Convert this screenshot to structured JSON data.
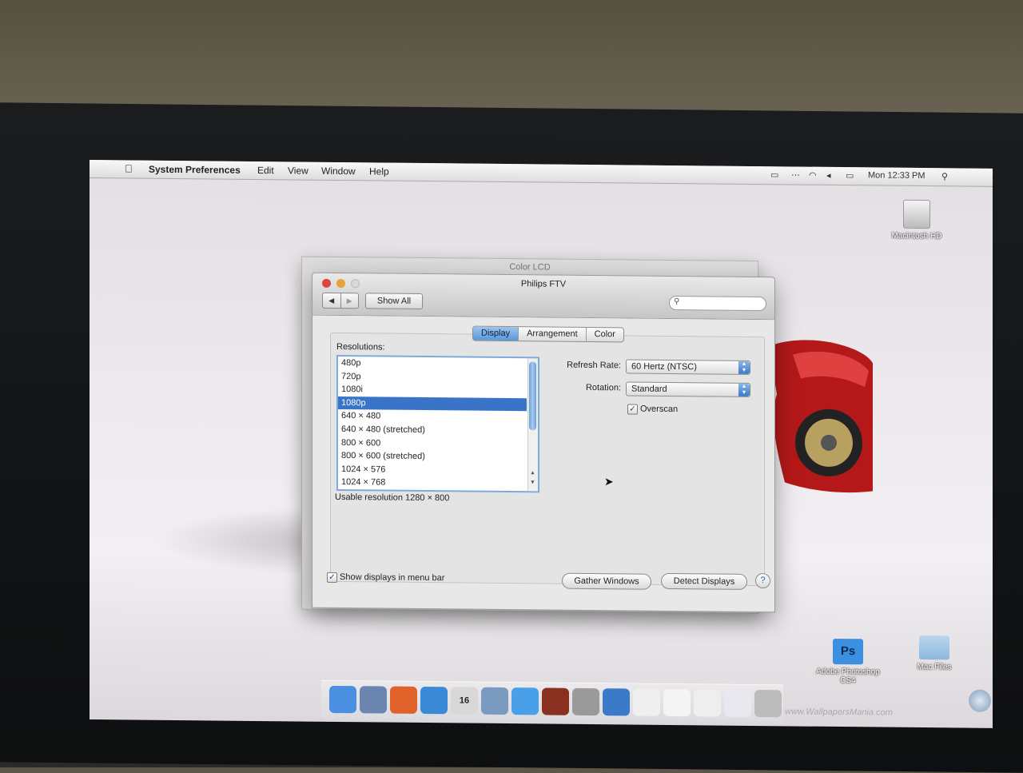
{
  "menubar": {
    "app_name": "System Preferences",
    "items": [
      "Edit",
      "View",
      "Window",
      "Help"
    ],
    "clock": "Mon 12:33 PM"
  },
  "desktop": {
    "icons": [
      {
        "label": "Macintosh HD",
        "icon": "hard-drive-icon"
      },
      {
        "label": "Adobe Photoshop CS4",
        "icon": "photoshop-icon"
      },
      {
        "label": "Mac Files",
        "icon": "folder-icon"
      }
    ],
    "ps_glyph": "Ps",
    "watermark": "www.WallpapersMania.com"
  },
  "back_window": {
    "title": "Color LCD"
  },
  "window": {
    "title": "Philips FTV",
    "toolbar": {
      "back": "◀",
      "forward": "▶",
      "show_all": "Show All",
      "search_placeholder": ""
    },
    "tabs": [
      {
        "label": "Display",
        "active": true
      },
      {
        "label": "Arrangement",
        "active": false
      },
      {
        "label": "Color",
        "active": false
      }
    ],
    "resolutions_label": "Resolutions:",
    "resolutions": [
      "480p",
      "720p",
      "1080i",
      "1080p",
      "640 × 480",
      "640 × 480 (stretched)",
      "800 × 600",
      "800 × 600 (stretched)",
      "1024 × 576",
      "1024 × 768"
    ],
    "selected_resolution": "1080p",
    "usable_resolution": "Usable resolution 1280 × 800",
    "refresh_rate_label": "Refresh Rate:",
    "refresh_rate_value": "60 Hertz (NTSC)",
    "rotation_label": "Rotation:",
    "rotation_value": "Standard",
    "overscan_label": "Overscan",
    "overscan_checked": true,
    "show_displays_label": "Show displays in menu bar",
    "show_displays_checked": true,
    "gather_windows": "Gather Windows",
    "detect_displays": "Detect Displays",
    "help": "?"
  },
  "dock": {
    "apps": [
      {
        "name": "finder-icon",
        "color": "#4a8fe0"
      },
      {
        "name": "preview-icon",
        "color": "#6a86b0"
      },
      {
        "name": "firefox-icon",
        "color": "#e0612a"
      },
      {
        "name": "safari-icon",
        "color": "#3a8ad8"
      },
      {
        "name": "ical-icon",
        "color": "#d8d8d8",
        "text": "16"
      },
      {
        "name": "iphoto-icon",
        "color": "#7a9ac0"
      },
      {
        "name": "itunes-icon",
        "color": "#4aa0e8"
      },
      {
        "name": "photo-booth-icon",
        "color": "#8a3020"
      },
      {
        "name": "system-preferences-icon",
        "color": "#9a9a9a"
      },
      {
        "name": "time-machine-icon",
        "color": "#3a7ac8"
      },
      {
        "name": "document-icon-1",
        "color": "#efefef"
      },
      {
        "name": "document-icon-2",
        "color": "#f4f4f4"
      },
      {
        "name": "document-icon-3",
        "color": "#eeeeee"
      },
      {
        "name": "document-icon-4",
        "color": "#e8e8ee"
      },
      {
        "name": "trash-icon",
        "color": "#bcbcbc"
      }
    ]
  }
}
